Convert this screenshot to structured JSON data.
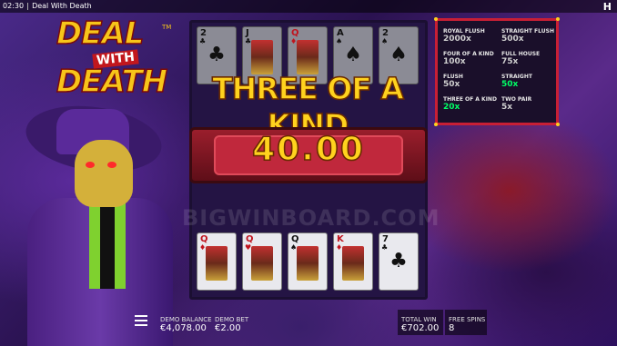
{
  "topbar": {
    "time": "02:30",
    "title": "Deal With Death"
  },
  "brand_icon": "H",
  "logo": {
    "line1": "DEAL",
    "line2": "WITH",
    "line3": "DEATH",
    "tm": "TM"
  },
  "win": {
    "hand": "THREE OF A KIND",
    "amount": "40.00"
  },
  "paytable": {
    "rows": [
      {
        "name": "ROYAL FLUSH",
        "mult": "2000x"
      },
      {
        "name": "STRAIGHT FLUSH",
        "mult": "500x"
      },
      {
        "name": "FOUR OF A KIND",
        "mult": "100x"
      },
      {
        "name": "FULL HOUSE",
        "mult": "75x"
      },
      {
        "name": "FLUSH",
        "mult": "50x"
      },
      {
        "name": "STRAIGHT",
        "mult": "50x"
      },
      {
        "name": "THREE OF A KIND",
        "mult": "20x"
      },
      {
        "name": "TWO PAIR",
        "mult": "5x"
      }
    ]
  },
  "reels": {
    "top_row": [
      {
        "rank": "2",
        "suit": "♣",
        "icon": "club-icon",
        "face": false
      },
      {
        "rank": "J",
        "suit": "♣",
        "icon": "club-icon",
        "face": true
      },
      {
        "rank": "Q",
        "suit": "♦",
        "icon": "diamond-icon",
        "face": true
      },
      {
        "rank": "A",
        "suit": "♠",
        "icon": "spade-icon",
        "face": false
      },
      {
        "rank": "2",
        "suit": "♠",
        "icon": "spade-icon",
        "face": false
      }
    ],
    "bottom_row": [
      {
        "rank": "Q",
        "suit": "♦",
        "icon": "diamond-icon",
        "face": true
      },
      {
        "rank": "Q",
        "suit": "♥",
        "icon": "heart-icon",
        "face": true
      },
      {
        "rank": "Q",
        "suit": "♠",
        "icon": "spade-icon",
        "face": true
      },
      {
        "rank": "K",
        "suit": "♦",
        "icon": "diamond-icon",
        "face": true
      },
      {
        "rank": "7",
        "suit": "♣",
        "icon": "club-icon",
        "face": false
      }
    ]
  },
  "watermark": "BIGWINBOARD.COM",
  "footer": {
    "demo_balance_label": "DEMO BALANCE",
    "demo_balance": "€4,078.00",
    "demo_bet_label": "DEMO BET",
    "demo_bet": "€2.00",
    "total_win_label": "TOTAL WIN",
    "total_win": "€702.00",
    "free_spins_label": "FREE SPINS",
    "free_spins": "8"
  },
  "colors": {
    "accent_gold": "#ffd21e",
    "paytable_border": "#c81f35",
    "highlight_green": "#00ff66"
  }
}
